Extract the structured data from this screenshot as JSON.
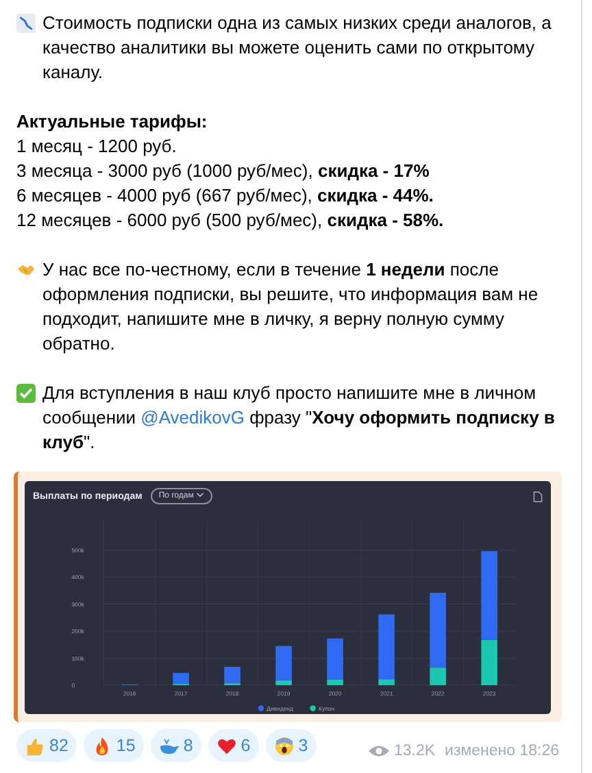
{
  "message": {
    "intro": "Стоимость подписки одна из самых низких среди аналогов, а качество аналитики вы можете оценить сами по открытому каналу.",
    "tariffs_title": "Актуальные тарифы:",
    "tariffs": [
      "1 месяц - 1200 руб.",
      "3 месяца - 3000 руб (1000 руб/мес), **скидка - 17%**",
      "6 месяцев - 4000 руб (667 руб/мес), **скидка - 44%.**",
      "12 месяцев - 6000 руб (500 руб/мес), **скидка - 58%.**"
    ],
    "guarantee": "У нас все по-честному, если в течение **1 недели** после оформления подписки, вы решите, что информация вам не подходит, напишите мне в личку, я верну полную сумму обратно.",
    "join_prefix": "Для вступления в наш клуб просто напишите мне в личном сообщении",
    "join_link": "@AvedikovG",
    "join_suffix": "фразу \"**Хочу оформить подписку в клуб**\".",
    "chart": {
      "title": "Выплаты по периодам",
      "period": "По годам",
      "chart_data": {
        "type": "bar",
        "stacked": true,
        "categories": [
          "2016",
          "2017",
          "2018",
          "2019",
          "2020",
          "2021",
          "2022",
          "2023"
        ],
        "series": [
          {
            "name": "Купон",
            "color": "#1ec8b0",
            "values": [
              0,
              5000,
              8000,
              18000,
              20000,
              22000,
              65000,
              168000
            ]
          },
          {
            "name": "Дивиденд",
            "color": "#2f6bf2",
            "values": [
              3000,
              40000,
              60000,
              127000,
              153000,
              240000,
              277000,
              328000
            ]
          }
        ],
        "ylim": [
          0,
          500000
        ],
        "grid": true,
        "yticks": [
          {
            "value": 0,
            "label": "0"
          },
          {
            "value": 100000,
            "label": "100k"
          },
          {
            "value": 200000,
            "label": "200k"
          },
          {
            "value": 300000,
            "label": "300k"
          },
          {
            "value": 400000,
            "label": "400k"
          },
          {
            "value": 500000,
            "label": "500k"
          }
        ],
        "legend": "bottom"
      }
    }
  },
  "reactions": [
    {
      "kind": "thumbs",
      "count": "82"
    },
    {
      "kind": "fire",
      "count": "15"
    },
    {
      "kind": "whale",
      "count": "8"
    },
    {
      "kind": "heart",
      "count": "6"
    },
    {
      "kind": "scream",
      "count": "3"
    }
  ],
  "views": "13.2K",
  "edited": "изменено 18:26"
}
